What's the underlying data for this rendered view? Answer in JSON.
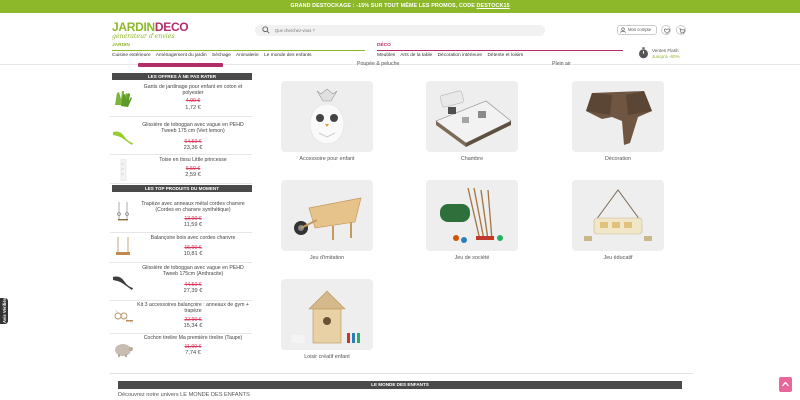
{
  "promo": {
    "text": "GRAND DESTOCKAGE : -15% SUR TOUT MÊME LES PROMOS, CODE ",
    "code": "DESTOCK15"
  },
  "logo": {
    "part1": "JARDIN",
    "part2": "DECO",
    "tagline": "générateur d'envies"
  },
  "search": {
    "placeholder": "Que cherchez-vous ?"
  },
  "account": {
    "label": "Mon compte"
  },
  "nav": {
    "jardin": {
      "title": "JARDIN",
      "items": [
        "Cuisine extérieure",
        "Aménagement du jardin",
        "Séchage",
        "Animalerie",
        "Le monde des enfants"
      ]
    },
    "deco": {
      "title": "DÉCO",
      "items": [
        "Meubles",
        "Arts de la table",
        "Décoration intérieure",
        "Détente et loisirs"
      ]
    }
  },
  "vente_flash": {
    "line1": "Ventes Flash",
    "line2": "Jusqu'à -60%"
  },
  "top_labels": {
    "left": "Poupée & peluche",
    "right": "Plein air"
  },
  "sidebar": {
    "offers_title": "LES OFFRES À NE PAS RATER",
    "offers": [
      {
        "name": "Gants de jardinage pour enfant en coton et polyester",
        "old": "4,90 €",
        "new": "1,72 €"
      },
      {
        "name": "Glissière de toboggan avec vague en PEHD Tweeb 175 cm (Vert lemon)",
        "old": "64,50 €",
        "new": "23,36 €"
      },
      {
        "name": "Toise en tissu Little princesse",
        "old": "6,50 €",
        "new": "2,59 €"
      }
    ],
    "top_title": "LES TOP PRODUITS DU MOMENT",
    "top": [
      {
        "name": "Trapèze avec anneaux métal cordes chanvre (Cordes en chanvre synthétique)",
        "old": "13,90 €",
        "new": "11,59 €"
      },
      {
        "name": "Balançoire bois avec cordes chanvre",
        "old": "15,90 €",
        "new": "10,81 €"
      },
      {
        "name": "Glissière de toboggan avec vague en PEHD Tweeb 175cm (Anthracite)",
        "old": "44,50 €",
        "new": "27,39 €"
      },
      {
        "name": "Kit 3 accessoires balançoire : anneaux de gym + trapèze",
        "old": "22,90 €",
        "new": "15,34 €"
      },
      {
        "name": "Cochon tirelire Ma première tirelire (Taupe)",
        "old": "11,90 €",
        "new": "7,74 €"
      }
    ]
  },
  "categories": [
    {
      "label": "Accessoire pour enfant"
    },
    {
      "label": "Chambre"
    },
    {
      "label": "Décoration"
    },
    {
      "label": "Jeu d'imitation"
    },
    {
      "label": "Jeu de société"
    },
    {
      "label": "Jeu éducatif"
    },
    {
      "label": "Loisir créatif enfant"
    }
  ],
  "bottom": {
    "bar_title": "LE MONDE DES ENFANTS",
    "text": "Découvrez notre univers LE MONDE DES ENFANTS"
  },
  "avis": {
    "label": "Avis Vérifiés"
  },
  "colors": {
    "green": "#8cb82a",
    "pink": "#b32d6b",
    "dark": "#4a4a4a"
  }
}
